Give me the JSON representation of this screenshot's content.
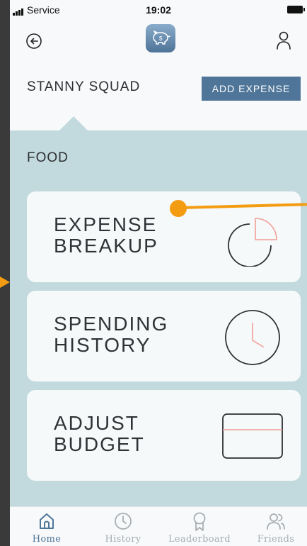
{
  "status_bar": {
    "carrier": "Service",
    "time": "19:02"
  },
  "header": {
    "squad_name": "STANNY SQUAD",
    "add_expense_label": "ADD EXPENSE"
  },
  "section": {
    "title": "FOOD"
  },
  "cards": [
    {
      "line1": "EXPENSE",
      "line2": "BREAKUP",
      "icon": "pie-chart-icon"
    },
    {
      "line1": "SPENDING",
      "line2": "HISTORY",
      "icon": "clock-icon"
    },
    {
      "line1": "ADJUST",
      "line2": "BUDGET",
      "icon": "card-icon"
    }
  ],
  "tabs": [
    {
      "label": "Home",
      "icon": "home-icon",
      "active": true
    },
    {
      "label": "History",
      "icon": "clock-icon",
      "active": false
    },
    {
      "label": "Leaderboard",
      "icon": "award-icon",
      "active": false
    },
    {
      "label": "Friends",
      "icon": "friends-icon",
      "active": false
    }
  ],
  "colors": {
    "accent": "#4f7598",
    "panel": "#c2dadd",
    "card": "#f6f9fa",
    "highlight": "#f2a8a2",
    "annotation": "#f39c12"
  }
}
